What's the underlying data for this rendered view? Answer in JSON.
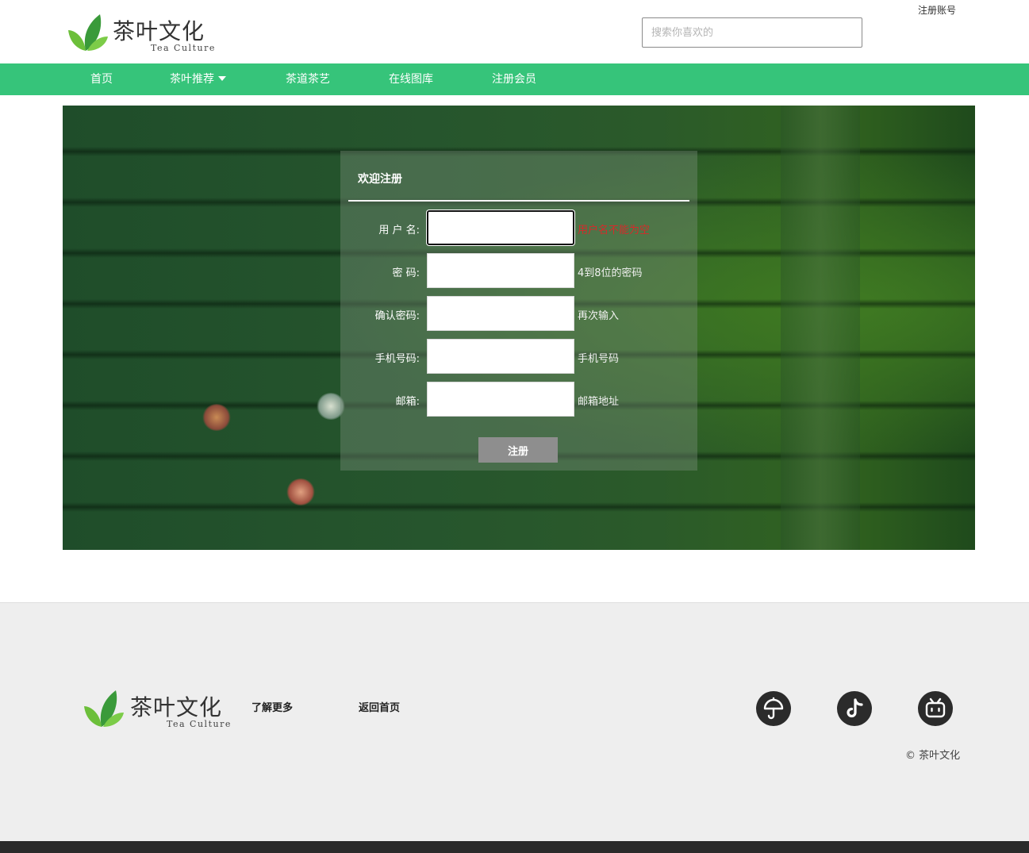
{
  "header": {
    "logo_name": "茶叶文化",
    "logo_sub": "Tea Culture",
    "search_placeholder": "搜索你喜欢的",
    "register_link": "注册账号"
  },
  "nav": {
    "items": [
      {
        "label": "首页"
      },
      {
        "label": "茶叶推荐"
      },
      {
        "label": "茶道茶艺"
      },
      {
        "label": "在线图库"
      },
      {
        "label": "注册会员"
      }
    ],
    "accent_color": "#36c47a"
  },
  "form": {
    "title": "欢迎注册",
    "fields": [
      {
        "label": "用 户 名:",
        "value": "",
        "hint": "用户名不能为空",
        "hint_state": "error"
      },
      {
        "label": "密      码:",
        "value": "",
        "hint": "4到8位的密码"
      },
      {
        "label": "确认密码:",
        "value": "",
        "hint": "再次输入"
      },
      {
        "label": "手机号码:",
        "value": "",
        "hint": "手机号码"
      },
      {
        "label": "邮箱:",
        "value": "",
        "hint": "邮箱地址"
      }
    ],
    "submit_label": "注册",
    "error_color": "#d62a2a"
  },
  "footer": {
    "logo_name": "茶叶文化",
    "logo_sub": "Tea Culture",
    "links": [
      {
        "label": "了解更多"
      },
      {
        "label": "返回首页"
      }
    ],
    "social": [
      {
        "icon": "umbrella-icon"
      },
      {
        "icon": "tiktok-icon"
      },
      {
        "icon": "bilibili-icon"
      }
    ],
    "copyright": "© 茶叶文化"
  }
}
